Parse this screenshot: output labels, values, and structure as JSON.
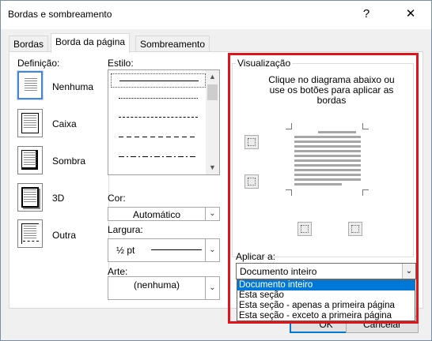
{
  "window": {
    "title": "Bordas e sombreamento",
    "help_label": "?",
    "close_label": "✕"
  },
  "tabs": [
    {
      "label": "Bordas",
      "active": false
    },
    {
      "label": "Borda da página",
      "active": true
    },
    {
      "label": "Sombreamento",
      "active": false
    }
  ],
  "definition": {
    "heading": "Definição:",
    "items": [
      {
        "label": "Nenhuma",
        "icon": "none-setting-icon",
        "selected": true
      },
      {
        "label": "Caixa",
        "icon": "box-setting-icon",
        "selected": false
      },
      {
        "label": "Sombra",
        "icon": "shadow-setting-icon",
        "selected": false
      },
      {
        "label": "3D",
        "icon": "3d-setting-icon",
        "selected": false
      },
      {
        "label": "Outra",
        "icon": "custom-setting-icon",
        "selected": false
      }
    ]
  },
  "style": {
    "heading": "Estilo:",
    "options": [
      "solid",
      "dotted",
      "dashed-small",
      "dashed-large",
      "dash-dot"
    ]
  },
  "color": {
    "heading": "Cor:",
    "value": "Automático"
  },
  "width": {
    "heading": "Largura:",
    "value": "½ pt"
  },
  "art": {
    "heading": "Arte:",
    "value": "(nenhuma)"
  },
  "preview": {
    "heading": "Visualização",
    "instruction": "Clique no diagrama abaixo ou use os botões para aplicar as bordas"
  },
  "apply": {
    "heading": "Aplicar a:",
    "value": "Documento inteiro",
    "options": [
      "Documento inteiro",
      "Esta seção",
      "Esta seção - apenas a primeira página",
      "Esta seção - exceto a primeira página"
    ]
  },
  "buttons": {
    "ok": "OK",
    "cancel": "Cancelar"
  },
  "colors": {
    "accent": "#0078d7",
    "highlight": "#e0141b"
  }
}
